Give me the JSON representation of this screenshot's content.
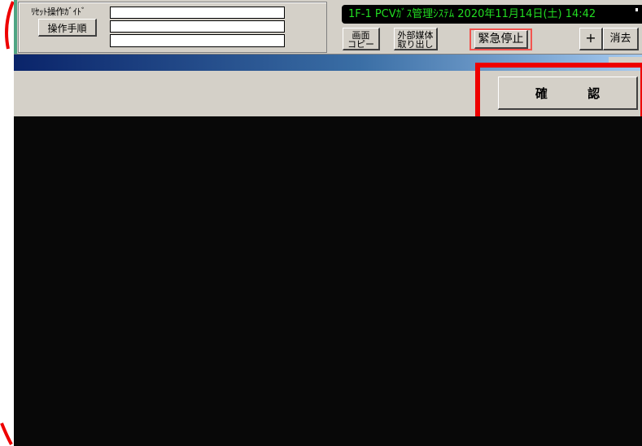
{
  "guide": {
    "title": "ﾘｾｯﾄ操作ｶﾞｲﾄﾞ",
    "manual_button": "操作手順",
    "lines": [
      "",
      "",
      ""
    ]
  },
  "status": {
    "text": "1F-1 PCVｶﾞｽ管理ｼｽﾃﾑ 2020年11月14日(土) 14:42"
  },
  "toolbar": {
    "copy_line1": "画面",
    "copy_line2": "コピー",
    "media_line1": "外部媒体",
    "media_line2": "取り出し",
    "estop": "緊急停止",
    "plus": "+",
    "clear": "消去"
  },
  "confirm": {
    "label": "確 認"
  },
  "colors": {
    "status_text": "#22dd22",
    "annotation_red": "#ee0000",
    "panel_gray": "#d4d0c8"
  }
}
